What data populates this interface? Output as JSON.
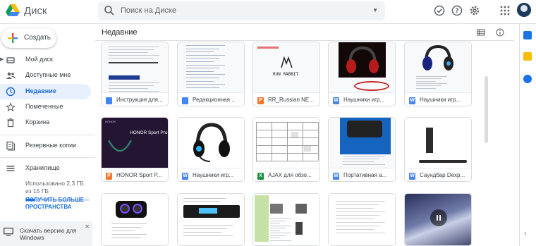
{
  "app": {
    "name": "Диск"
  },
  "search": {
    "placeholder": "Поиск на Диске"
  },
  "sidebar": {
    "create_label": "Создать",
    "items": [
      {
        "label": "Мой диск",
        "icon": "my-drive-icon"
      },
      {
        "label": "Доступные мне",
        "icon": "shared-icon"
      },
      {
        "label": "Недавние",
        "icon": "recent-icon",
        "active": true
      },
      {
        "label": "Помеченные",
        "icon": "star-icon"
      },
      {
        "label": "Корзина",
        "icon": "trash-icon"
      },
      {
        "label": "Резервные копии",
        "icon": "backup-icon"
      },
      {
        "label": "Хранилище",
        "icon": "storage-icon"
      }
    ],
    "storage_text": "Использовано 2,3 ГБ из 15 ГБ",
    "storage_used_fraction": 0.153,
    "upgrade_label": "ПОЛУЧИТЬ БОЛЬШЕ ПРОСТРАНСТВА",
    "download_label": "Скачать версию для Windows"
  },
  "main": {
    "title": "Недавние",
    "files": [
      {
        "name": "Инструкция для...",
        "type": "docs",
        "type_letter": "",
        "thumb": "doc"
      },
      {
        "name": "Редакционная ...",
        "type": "docs",
        "type_letter": "",
        "thumb": "doc2"
      },
      {
        "name": "RR_Russian NE...",
        "type": "slides",
        "type_letter": "P",
        "thumb": "runrabbit"
      },
      {
        "name": "Наушники игр...",
        "type": "word",
        "type_letter": "W",
        "thumb": "headset-red"
      },
      {
        "name": "Наушники игр...",
        "type": "word",
        "type_letter": "W",
        "thumb": "headset-blue"
      },
      {
        "name": "HONOR Sport P...",
        "type": "slides",
        "type_letter": "P",
        "thumb": "honor"
      },
      {
        "name": "Наушники игр...",
        "type": "word",
        "type_letter": "W",
        "thumb": "headset-white"
      },
      {
        "name": "AJAX для обзо...",
        "type": "sheets",
        "type_letter": "X",
        "thumb": "table"
      },
      {
        "name": "Портативная а...",
        "type": "word",
        "type_letter": "W",
        "thumb": "speaker"
      },
      {
        "name": "Саундбар Dexp...",
        "type": "word",
        "type_letter": "W",
        "thumb": "soundbar"
      },
      {
        "name": "",
        "type": "",
        "type_letter": "",
        "thumb": "boombox"
      },
      {
        "name": "",
        "type": "",
        "type_letter": "",
        "thumb": "car-radio"
      },
      {
        "name": "",
        "type": "",
        "type_letter": "",
        "thumb": "sheet-photos"
      },
      {
        "name": "",
        "type": "",
        "type_letter": "",
        "thumb": "doc3"
      },
      {
        "name": "",
        "type": "",
        "type_letter": "",
        "thumb": "video"
      }
    ]
  },
  "thumb_texts": {
    "honor_title": "HONOR Sport Pro",
    "honor_brand": "HONOR",
    "runrabbit": "RUN RABBIT"
  },
  "colors": {
    "accent": "#1a73e8",
    "active_bg": "#e8f0fe",
    "docs": "#4285f4",
    "slides": "#f4772e",
    "word": "#4a86e8",
    "sheets": "#1e8e3e"
  }
}
